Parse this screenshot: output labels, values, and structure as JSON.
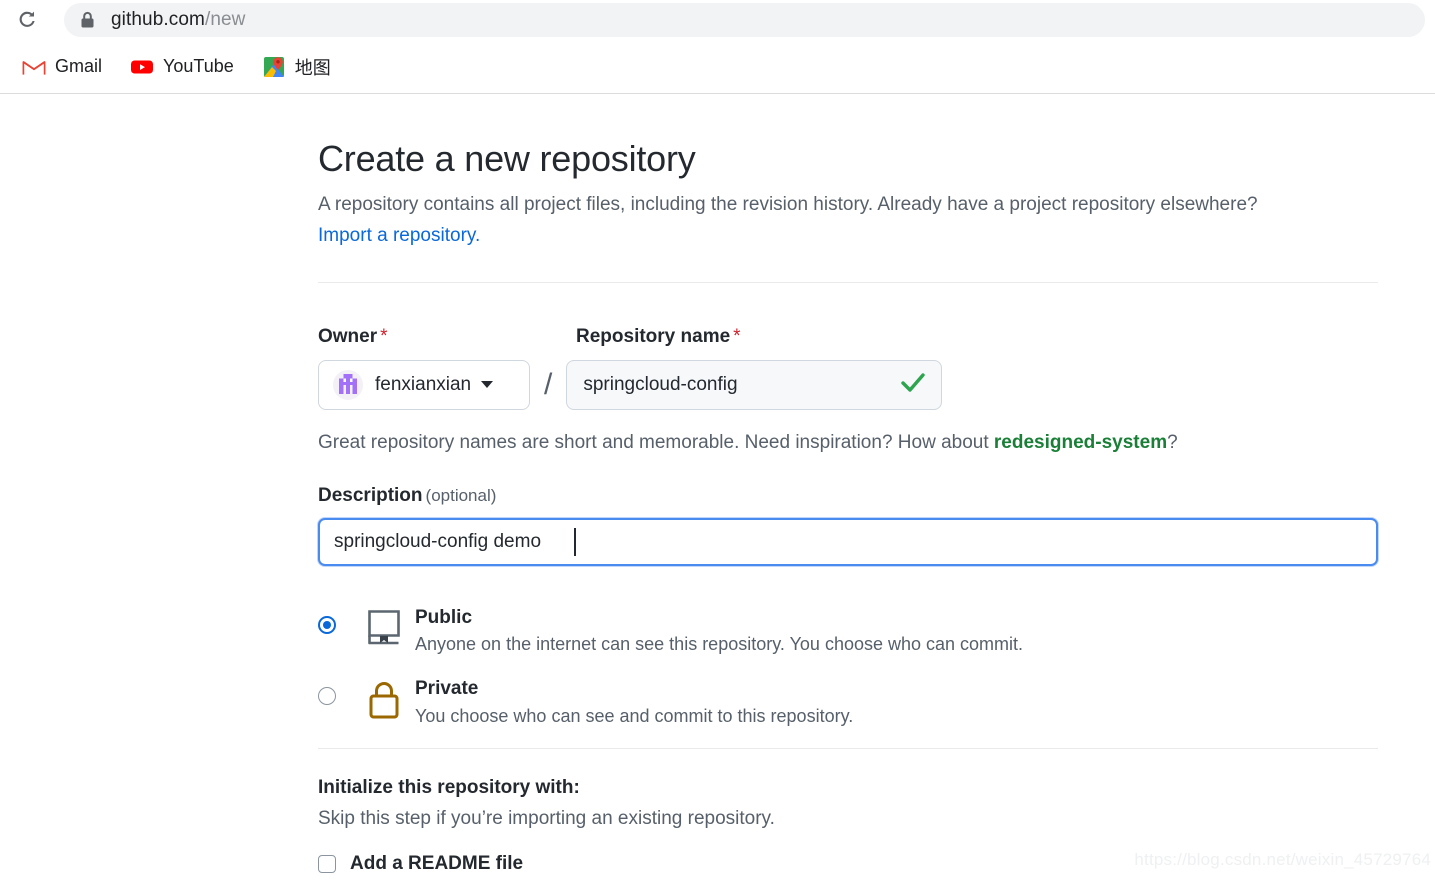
{
  "browser": {
    "reload_icon": "reload-icon",
    "lock_icon": "lock-icon",
    "url_domain": "github.com",
    "url_path": "/new",
    "bookmarks": [
      {
        "label": "Gmail",
        "icon": "gmail-icon"
      },
      {
        "label": "YouTube",
        "icon": "youtube-icon"
      },
      {
        "label": "地图",
        "icon": "google-maps-icon"
      }
    ]
  },
  "page": {
    "title": "Create a new repository",
    "lede_text": "A repository contains all project files, including the revision history. Already have a project repository elsewhere?",
    "lede_link": "Import a repository."
  },
  "form": {
    "owner": {
      "label": "Owner",
      "required_mark": "*",
      "value": "fenxianxian",
      "avatar_icon": "identicon-avatar",
      "caret_icon": "chevron-down-icon"
    },
    "separator": "/",
    "repo_name": {
      "label": "Repository name",
      "required_mark": "*",
      "value": "springcloud-config",
      "placeholder": "",
      "valid_icon": "check-icon"
    },
    "hint": {
      "prefix": "Great repository names are short and memorable. Need inspiration? How about ",
      "suggestion": "redesigned-system",
      "suffix": "?"
    },
    "description": {
      "label": "Description",
      "optional": "(optional)",
      "value": "springcloud-config demo",
      "placeholder": ""
    },
    "visibility": {
      "options": [
        {
          "id": "public",
          "title": "Public",
          "description": "Anyone on the internet can see this repository. You choose who can commit.",
          "icon": "repo-book-icon",
          "selected": true
        },
        {
          "id": "private",
          "title": "Private",
          "description": "You choose who can see and commit to this repository.",
          "icon": "lock-icon",
          "selected": false
        }
      ]
    },
    "initialize": {
      "title": "Initialize this repository with:",
      "subtitle": "Skip this step if you’re importing an existing repository.",
      "readme_label": "Add a README file",
      "readme_checked": false
    }
  },
  "colors": {
    "accent_blue": "#0969da",
    "link_blue": "#0969da",
    "success_green": "#1a7f37",
    "required_red": "#cf222e",
    "lock_gold": "#9a6700",
    "text_primary": "#24292f",
    "text_muted": "#57606a",
    "avatar_purple": "#a371f7"
  },
  "watermark": "https://blog.csdn.net/weixin_45729764"
}
